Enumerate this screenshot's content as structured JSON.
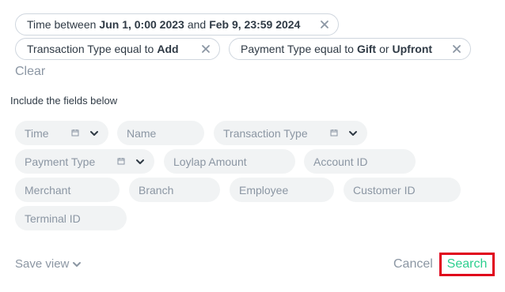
{
  "filters": [
    {
      "parts": [
        "Time between",
        "Jun 1, 0:00 2023",
        "and",
        "Feb 9, 23:59 2024"
      ]
    },
    {
      "parts": [
        "Transaction Type equal to",
        "Add"
      ]
    },
    {
      "parts": [
        "Payment Type equal to",
        "Gift",
        "or",
        "Upfront"
      ]
    }
  ],
  "clear_label": "Clear",
  "fields_title": "Include the fields below",
  "fields": [
    "Time",
    "Name",
    "Transaction Type",
    "Payment Type",
    "Loylap Amount",
    "Account ID",
    "Merchant",
    "Branch",
    "Employee",
    "Customer ID",
    "Terminal ID"
  ],
  "footer": {
    "save_view_label": "Save view",
    "cancel_label": "Cancel",
    "search_label": "Search"
  },
  "colors": {
    "accent_green": "#2ccf8f",
    "highlight_red": "#e0001b",
    "muted_text": "#8b96a3",
    "chip_border": "#cfd6de",
    "field_bg": "#f1f3f4"
  }
}
